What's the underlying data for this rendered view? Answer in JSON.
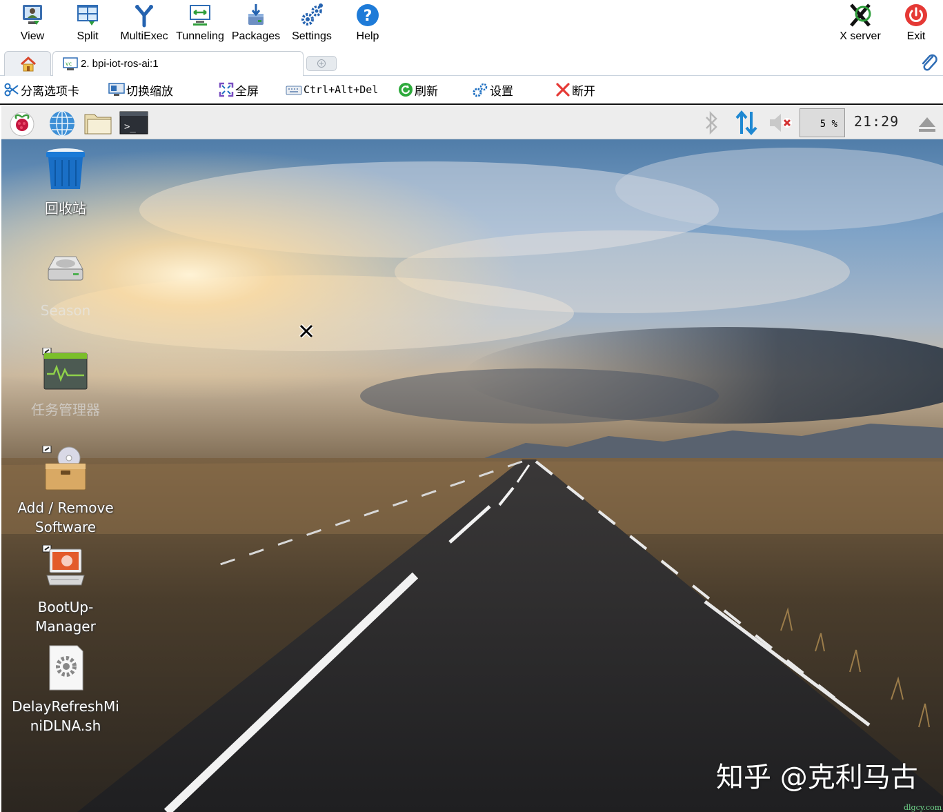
{
  "toolbar": {
    "items": [
      {
        "label": "View",
        "icon": "view-icon"
      },
      {
        "label": "Split",
        "icon": "split-icon"
      },
      {
        "label": "MultiExec",
        "icon": "multiexec-icon"
      },
      {
        "label": "Tunneling",
        "icon": "tunneling-icon"
      },
      {
        "label": "Packages",
        "icon": "packages-icon"
      },
      {
        "label": "Settings",
        "icon": "settings-icon"
      },
      {
        "label": "Help",
        "icon": "help-icon"
      }
    ],
    "right_items": [
      {
        "label": "X server",
        "icon": "x-server-icon"
      },
      {
        "label": "Exit",
        "icon": "power-icon"
      }
    ]
  },
  "tabs": {
    "home_icon": "home-icon",
    "active_tab": "2. bpi-iot-ros-ai:1",
    "attach_icon": "paperclip-icon"
  },
  "session_toolbar": {
    "items": [
      {
        "label": "分离选项卡",
        "icon": "scissors-icon"
      },
      {
        "label": "切换缩放",
        "icon": "monitor-icon"
      },
      {
        "label": "全屏",
        "icon": "fullscreen-icon"
      },
      {
        "label": "Ctrl+Alt+Del",
        "icon": "keyboard-icon"
      },
      {
        "label": "刷新",
        "icon": "refresh-icon"
      },
      {
        "label": "设置",
        "icon": "settings-icon"
      },
      {
        "label": "断开",
        "icon": "disconnect-icon"
      }
    ]
  },
  "panel": {
    "launchers": [
      "raspberry-menu-icon",
      "web-browser-icon",
      "file-manager-icon",
      "terminal-icon"
    ],
    "tray": [
      "bluetooth-icon",
      "network-icon",
      "volume-muted-icon"
    ],
    "cpu_usage": "5 %",
    "clock": "21:29",
    "eject_icon": "eject-icon"
  },
  "desktop_icons": [
    {
      "label": "回收站",
      "icon": "trash-icon"
    },
    {
      "label": "Season",
      "icon": "drive-icon"
    },
    {
      "label": "任务管理器",
      "icon": "task-manager-icon"
    },
    {
      "label": "Add / Remove\nSoftware",
      "line1": "Add / Remove",
      "line2": "Software",
      "icon": "package-installer-icon"
    },
    {
      "label": "BootUp-\nManager",
      "line1": "BootUp-",
      "line2": "Manager",
      "icon": "bootup-manager-icon"
    },
    {
      "label": "DelayRefreshMi\nniDLNA.sh",
      "line1": "DelayRefreshMi",
      "line2": "niDLNA.sh",
      "icon": "script-file-icon"
    }
  ],
  "watermark": "知乎 @克利马古",
  "watermark_small": "dlgcy.com",
  "colors": {
    "accent_blue": "#1e7bd8",
    "exit_red": "#e53935",
    "sky_top": "#3f6f9e",
    "road": "#2a2a2c"
  }
}
